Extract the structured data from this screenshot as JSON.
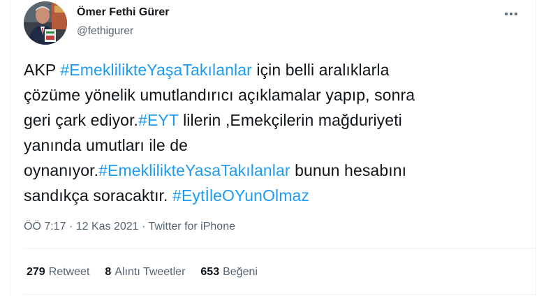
{
  "author": {
    "name": "Ömer Fethi Gürer",
    "handle": "@fethigurer"
  },
  "tweet": {
    "lines": [
      [
        {
          "text": "AKP ",
          "tag": false
        },
        {
          "text": "#EmeklilikteYaşaTakılanlar",
          "tag": true
        },
        {
          "text": " için belli aralıklarla",
          "tag": false
        }
      ],
      [
        {
          "text": "çözüme yönelik umutlandırıcı açıklamalar yapıp, sonra",
          "tag": false
        }
      ],
      [
        {
          "text": "geri çark ediyor.",
          "tag": false
        },
        {
          "text": "#EYT",
          "tag": true
        },
        {
          "text": " lilerin ,Emekçilerin mağduriyeti",
          "tag": false
        }
      ],
      [
        {
          "text": "yanında umutları ile de",
          "tag": false
        }
      ],
      [
        {
          "text": "oynanıyor.",
          "tag": false
        },
        {
          "text": "#EmeklilikteYasaTakılanlar",
          "tag": true
        },
        {
          "text": " bunun hesabını",
          "tag": false
        }
      ],
      [
        {
          "text": "sandıkça soracaktır. ",
          "tag": false
        },
        {
          "text": "#EytİleOYunOlmaz",
          "tag": true
        }
      ]
    ]
  },
  "meta": {
    "time": "ÖÖ 7:17",
    "sep1": " · ",
    "date": "12 Kas 2021",
    "sep2": " · ",
    "source": "Twitter for iPhone"
  },
  "stats": {
    "retweets_count": "279",
    "retweets_label": "Retweet",
    "quotes_count": "8",
    "quotes_label": "Alıntı Tweetler",
    "likes_count": "653",
    "likes_label": "Beğeni"
  },
  "colors": {
    "link": "#1d9bf0",
    "text": "#0f1419",
    "secondary": "#536471",
    "divider": "#eff3f4"
  },
  "icons": {
    "more": "more-horizontal-icon"
  }
}
